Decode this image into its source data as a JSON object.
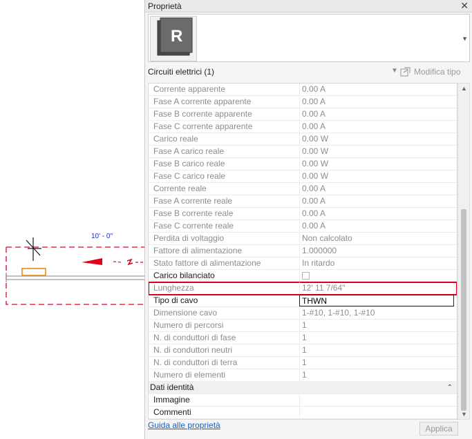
{
  "canvas": {
    "dimension": "10' - 0\""
  },
  "panel": {
    "title": "Proprietà",
    "close_glyph": "✕",
    "type_icon_letter": "R",
    "selection": "Circuiti elettrici (1)",
    "edit_type_label": "Modifica tipo",
    "rows": [
      {
        "label": "Corrente apparente",
        "value": "0.00 A",
        "state": "dis"
      },
      {
        "label": "Fase A corrente apparente",
        "value": "0.00 A",
        "state": "dis"
      },
      {
        "label": "Fase B corrente apparente",
        "value": "0.00 A",
        "state": "dis"
      },
      {
        "label": "Fase C corrente apparente",
        "value": "0.00 A",
        "state": "dis"
      },
      {
        "label": "Carico reale",
        "value": "0.00 W",
        "state": "dis"
      },
      {
        "label": "Fase A carico reale",
        "value": "0.00 W",
        "state": "dis"
      },
      {
        "label": "Fase B carico reale",
        "value": "0.00 W",
        "state": "dis"
      },
      {
        "label": "Fase C carico reale",
        "value": "0.00 W",
        "state": "dis"
      },
      {
        "label": "Corrente reale",
        "value": "0.00 A",
        "state": "dis"
      },
      {
        "label": "Fase A corrente reale",
        "value": "0.00 A",
        "state": "dis"
      },
      {
        "label": "Fase B corrente reale",
        "value": "0.00 A",
        "state": "dis"
      },
      {
        "label": "Fase C corrente reale",
        "value": "0.00 A",
        "state": "dis"
      },
      {
        "label": "Perdita di voltaggio",
        "value": "Non calcolato",
        "state": "dis"
      },
      {
        "label": "Fattore di alimentazione",
        "value": "1.000000",
        "state": "dis"
      },
      {
        "label": "Stato fattore di alimentazione",
        "value": "In ritardo",
        "state": "dis"
      },
      {
        "label": "Carico bilanciato",
        "value": "",
        "state": "en",
        "checkbox": true
      },
      {
        "label": "Lunghezza",
        "value": "12'  11 7/64\"",
        "state": "dis",
        "highlight": true
      },
      {
        "label": "Tipo di cavo",
        "value": "THWN",
        "state": "en",
        "input": true
      },
      {
        "label": "Dimensione cavo",
        "value": "1-#10, 1-#10, 1-#10",
        "state": "dis"
      },
      {
        "label": "Numero di percorsi",
        "value": "1",
        "state": "dis"
      },
      {
        "label": "N. di conduttori di fase",
        "value": "1",
        "state": "dis"
      },
      {
        "label": "N. di conduttori neutri",
        "value": "1",
        "state": "dis"
      },
      {
        "label": "N. di conduttori di terra",
        "value": "1",
        "state": "dis"
      },
      {
        "label": "Numero di elementi",
        "value": "1",
        "state": "dis"
      }
    ],
    "group": {
      "label": "Dati identità",
      "collapse_glyph": "⌃"
    },
    "group_rows": [
      {
        "label": "Immagine",
        "value": "",
        "state": "en"
      },
      {
        "label": "Commenti",
        "value": "",
        "state": "en"
      }
    ],
    "help_link": "Guida alle proprietà",
    "apply_label": "Applica"
  },
  "colors": {
    "highlight": "#d6001c",
    "wire_red": "#e0001b",
    "fixture_orange": "#e88a12",
    "dim_blue": "#1a2fb4"
  }
}
